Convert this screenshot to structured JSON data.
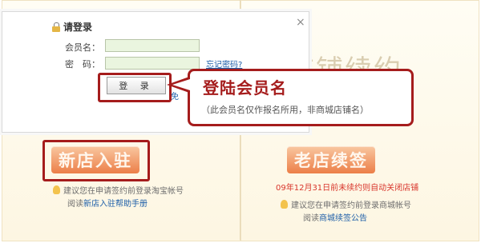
{
  "background": {
    "ghost_title": "店铺续约",
    "new_store_button": "新店入驻",
    "old_store_button": "老店续签",
    "red_note": "09年12月31日前未续约则自动关闭店铺",
    "tip_left_line1": "建议您在申请签约前登录淘宝帐号",
    "tip_left_line2_prefix": "阅读",
    "tip_left_line2_link": "新店入驻帮助手册",
    "tip_right_line1": "建议您在申请签约前登录商城帐号",
    "tip_right_line2_prefix": "阅读",
    "tip_right_line2_link": "商城续签公告"
  },
  "dialog": {
    "title": "请登录",
    "close": "×",
    "username_label": "会员名：",
    "username_value": "",
    "password_label": "密　码：",
    "password_value": "",
    "forgot_link": "忘记密码?",
    "login_button": "登 录",
    "partial_link": "免"
  },
  "callout": {
    "title": "登陆会员名",
    "note": "（此会员名仅作报名所用，非商城店铺名）"
  },
  "colors": {
    "highlight": "#a51c1c",
    "button_orange": "#ec7f48",
    "link_blue": "#1d5ea8",
    "input_green": "#eaf5df"
  }
}
